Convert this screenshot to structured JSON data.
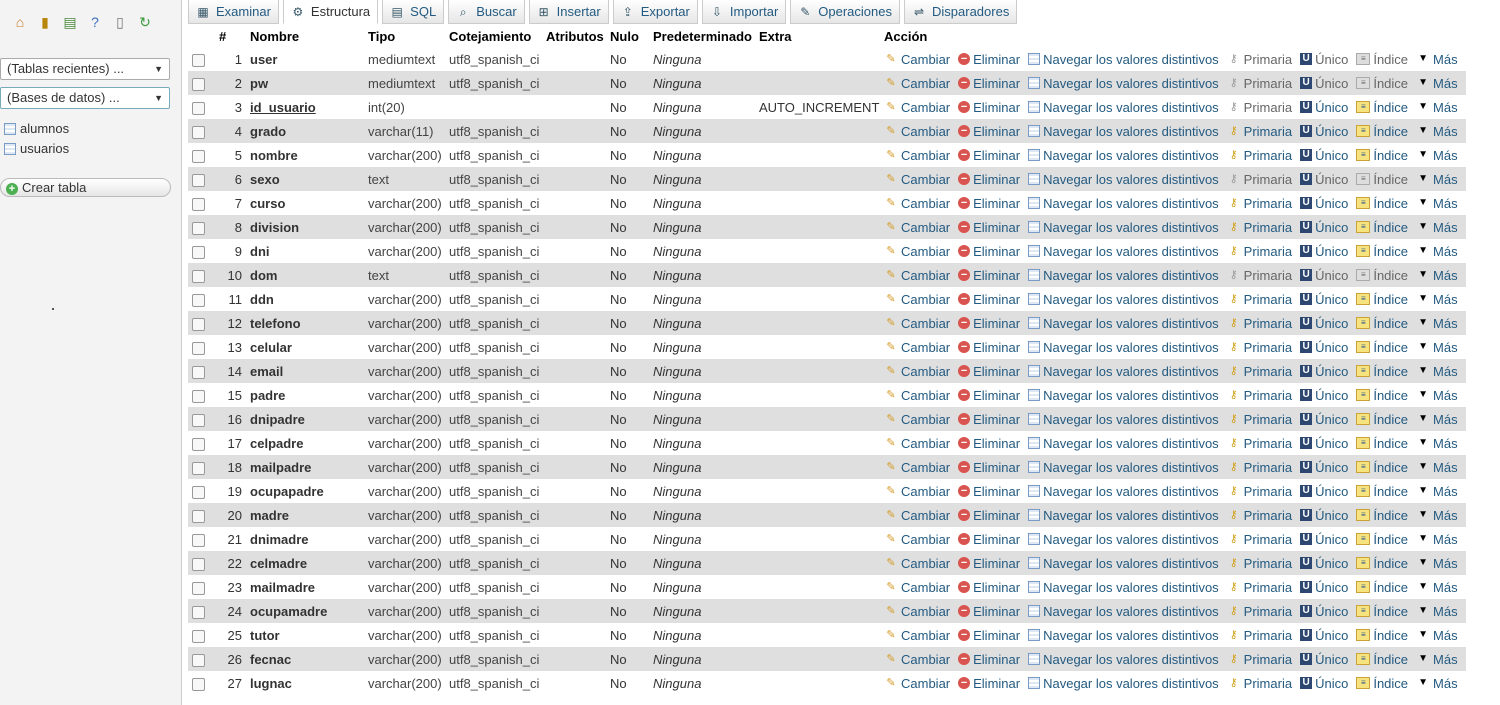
{
  "nav": {
    "recent_tables": "(Tablas recientes) ...",
    "databases": "(Bases de datos) ...",
    "tables": [
      "alumnos",
      "usuarios"
    ],
    "create_table": "Crear tabla"
  },
  "tabs": [
    {
      "label": "Examinar",
      "icon": "browse-icon"
    },
    {
      "label": "Estructura",
      "icon": "structure-icon",
      "active": true
    },
    {
      "label": "SQL",
      "icon": "sql-icon"
    },
    {
      "label": "Buscar",
      "icon": "search-icon"
    },
    {
      "label": "Insertar",
      "icon": "insert-icon"
    },
    {
      "label": "Exportar",
      "icon": "export-icon"
    },
    {
      "label": "Importar",
      "icon": "import-icon"
    },
    {
      "label": "Operaciones",
      "icon": "wrench-icon"
    },
    {
      "label": "Disparadores",
      "icon": "triggers-icon"
    }
  ],
  "columns": [
    "#",
    "Nombre",
    "Tipo",
    "Cotejamiento",
    "Atributos",
    "Nulo",
    "Predeterminado",
    "Extra",
    "Acción"
  ],
  "actions": {
    "change": "Cambiar",
    "drop": "Eliminar",
    "browse_distinct": "Navegar los valores distintivos",
    "primary": "Primaria",
    "unique": "Único",
    "index": "Índice",
    "more": "Más"
  },
  "fields": [
    {
      "n": "1",
      "name": "user",
      "type": "mediumtext",
      "collation": "utf8_spanish_ci",
      "attributes": "",
      "null": "No",
      "default": "Ninguna",
      "extra": "",
      "pk": false,
      "text": true
    },
    {
      "n": "2",
      "name": "pw",
      "type": "mediumtext",
      "collation": "utf8_spanish_ci",
      "attributes": "",
      "null": "No",
      "default": "Ninguna",
      "extra": "",
      "pk": false,
      "text": true
    },
    {
      "n": "3",
      "name": "id_usuario",
      "type": "int(20)",
      "collation": "",
      "attributes": "",
      "null": "No",
      "default": "Ninguna",
      "extra": "AUTO_INCREMENT",
      "pk": true,
      "text": false
    },
    {
      "n": "4",
      "name": "grado",
      "type": "varchar(11)",
      "collation": "utf8_spanish_ci",
      "attributes": "",
      "null": "No",
      "default": "Ninguna",
      "extra": "",
      "pk": false,
      "text": false
    },
    {
      "n": "5",
      "name": "nombre",
      "type": "varchar(200)",
      "collation": "utf8_spanish_ci",
      "attributes": "",
      "null": "No",
      "default": "Ninguna",
      "extra": "",
      "pk": false,
      "text": false
    },
    {
      "n": "6",
      "name": "sexo",
      "type": "text",
      "collation": "utf8_spanish_ci",
      "attributes": "",
      "null": "No",
      "default": "Ninguna",
      "extra": "",
      "pk": false,
      "text": true
    },
    {
      "n": "7",
      "name": "curso",
      "type": "varchar(200)",
      "collation": "utf8_spanish_ci",
      "attributes": "",
      "null": "No",
      "default": "Ninguna",
      "extra": "",
      "pk": false,
      "text": false
    },
    {
      "n": "8",
      "name": "division",
      "type": "varchar(200)",
      "collation": "utf8_spanish_ci",
      "attributes": "",
      "null": "No",
      "default": "Ninguna",
      "extra": "",
      "pk": false,
      "text": false
    },
    {
      "n": "9",
      "name": "dni",
      "type": "varchar(200)",
      "collation": "utf8_spanish_ci",
      "attributes": "",
      "null": "No",
      "default": "Ninguna",
      "extra": "",
      "pk": false,
      "text": false
    },
    {
      "n": "10",
      "name": "dom",
      "type": "text",
      "collation": "utf8_spanish_ci",
      "attributes": "",
      "null": "No",
      "default": "Ninguna",
      "extra": "",
      "pk": false,
      "text": true
    },
    {
      "n": "11",
      "name": "ddn",
      "type": "varchar(200)",
      "collation": "utf8_spanish_ci",
      "attributes": "",
      "null": "No",
      "default": "Ninguna",
      "extra": "",
      "pk": false,
      "text": false
    },
    {
      "n": "12",
      "name": "telefono",
      "type": "varchar(200)",
      "collation": "utf8_spanish_ci",
      "attributes": "",
      "null": "No",
      "default": "Ninguna",
      "extra": "",
      "pk": false,
      "text": false
    },
    {
      "n": "13",
      "name": "celular",
      "type": "varchar(200)",
      "collation": "utf8_spanish_ci",
      "attributes": "",
      "null": "No",
      "default": "Ninguna",
      "extra": "",
      "pk": false,
      "text": false
    },
    {
      "n": "14",
      "name": "email",
      "type": "varchar(200)",
      "collation": "utf8_spanish_ci",
      "attributes": "",
      "null": "No",
      "default": "Ninguna",
      "extra": "",
      "pk": false,
      "text": false
    },
    {
      "n": "15",
      "name": "padre",
      "type": "varchar(200)",
      "collation": "utf8_spanish_ci",
      "attributes": "",
      "null": "No",
      "default": "Ninguna",
      "extra": "",
      "pk": false,
      "text": false
    },
    {
      "n": "16",
      "name": "dnipadre",
      "type": "varchar(200)",
      "collation": "utf8_spanish_ci",
      "attributes": "",
      "null": "No",
      "default": "Ninguna",
      "extra": "",
      "pk": false,
      "text": false
    },
    {
      "n": "17",
      "name": "celpadre",
      "type": "varchar(200)",
      "collation": "utf8_spanish_ci",
      "attributes": "",
      "null": "No",
      "default": "Ninguna",
      "extra": "",
      "pk": false,
      "text": false
    },
    {
      "n": "18",
      "name": "mailpadre",
      "type": "varchar(200)",
      "collation": "utf8_spanish_ci",
      "attributes": "",
      "null": "No",
      "default": "Ninguna",
      "extra": "",
      "pk": false,
      "text": false
    },
    {
      "n": "19",
      "name": "ocupapadre",
      "type": "varchar(200)",
      "collation": "utf8_spanish_ci",
      "attributes": "",
      "null": "No",
      "default": "Ninguna",
      "extra": "",
      "pk": false,
      "text": false
    },
    {
      "n": "20",
      "name": "madre",
      "type": "varchar(200)",
      "collation": "utf8_spanish_ci",
      "attributes": "",
      "null": "No",
      "default": "Ninguna",
      "extra": "",
      "pk": false,
      "text": false
    },
    {
      "n": "21",
      "name": "dnimadre",
      "type": "varchar(200)",
      "collation": "utf8_spanish_ci",
      "attributes": "",
      "null": "No",
      "default": "Ninguna",
      "extra": "",
      "pk": false,
      "text": false
    },
    {
      "n": "22",
      "name": "celmadre",
      "type": "varchar(200)",
      "collation": "utf8_spanish_ci",
      "attributes": "",
      "null": "No",
      "default": "Ninguna",
      "extra": "",
      "pk": false,
      "text": false
    },
    {
      "n": "23",
      "name": "mailmadre",
      "type": "varchar(200)",
      "collation": "utf8_spanish_ci",
      "attributes": "",
      "null": "No",
      "default": "Ninguna",
      "extra": "",
      "pk": false,
      "text": false
    },
    {
      "n": "24",
      "name": "ocupamadre",
      "type": "varchar(200)",
      "collation": "utf8_spanish_ci",
      "attributes": "",
      "null": "No",
      "default": "Ninguna",
      "extra": "",
      "pk": false,
      "text": false
    },
    {
      "n": "25",
      "name": "tutor",
      "type": "varchar(200)",
      "collation": "utf8_spanish_ci",
      "attributes": "",
      "null": "No",
      "default": "Ninguna",
      "extra": "",
      "pk": false,
      "text": false
    },
    {
      "n": "26",
      "name": "fecnac",
      "type": "varchar(200)",
      "collation": "utf8_spanish_ci",
      "attributes": "",
      "null": "No",
      "default": "Ninguna",
      "extra": "",
      "pk": false,
      "text": false
    },
    {
      "n": "27",
      "name": "lugnac",
      "type": "varchar(200)",
      "collation": "utf8_spanish_ci",
      "attributes": "",
      "null": "No",
      "default": "Ninguna",
      "extra": "",
      "pk": false,
      "text": false
    }
  ]
}
